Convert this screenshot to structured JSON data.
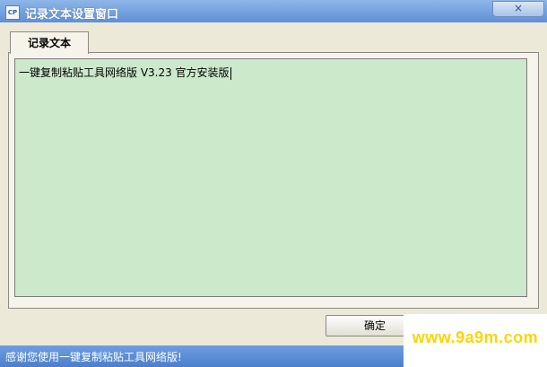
{
  "window": {
    "title": "记录文本设置窗口",
    "icon_text": "CP",
    "close_glyph": "×"
  },
  "tabs": [
    {
      "label": "记录文本",
      "selected": true
    }
  ],
  "editor": {
    "value": "一键复制粘贴工具网络版 V3.23 官方安装版",
    "background_color": "#cce9cc"
  },
  "buttons": {
    "ok_label": "确定"
  },
  "statusbar": {
    "text": "感谢您使用一键复制粘贴工具网络版!"
  },
  "watermark": {
    "text": "www.9a9m.com"
  },
  "icons": {
    "app": "app-icon",
    "close": "close-icon"
  }
}
